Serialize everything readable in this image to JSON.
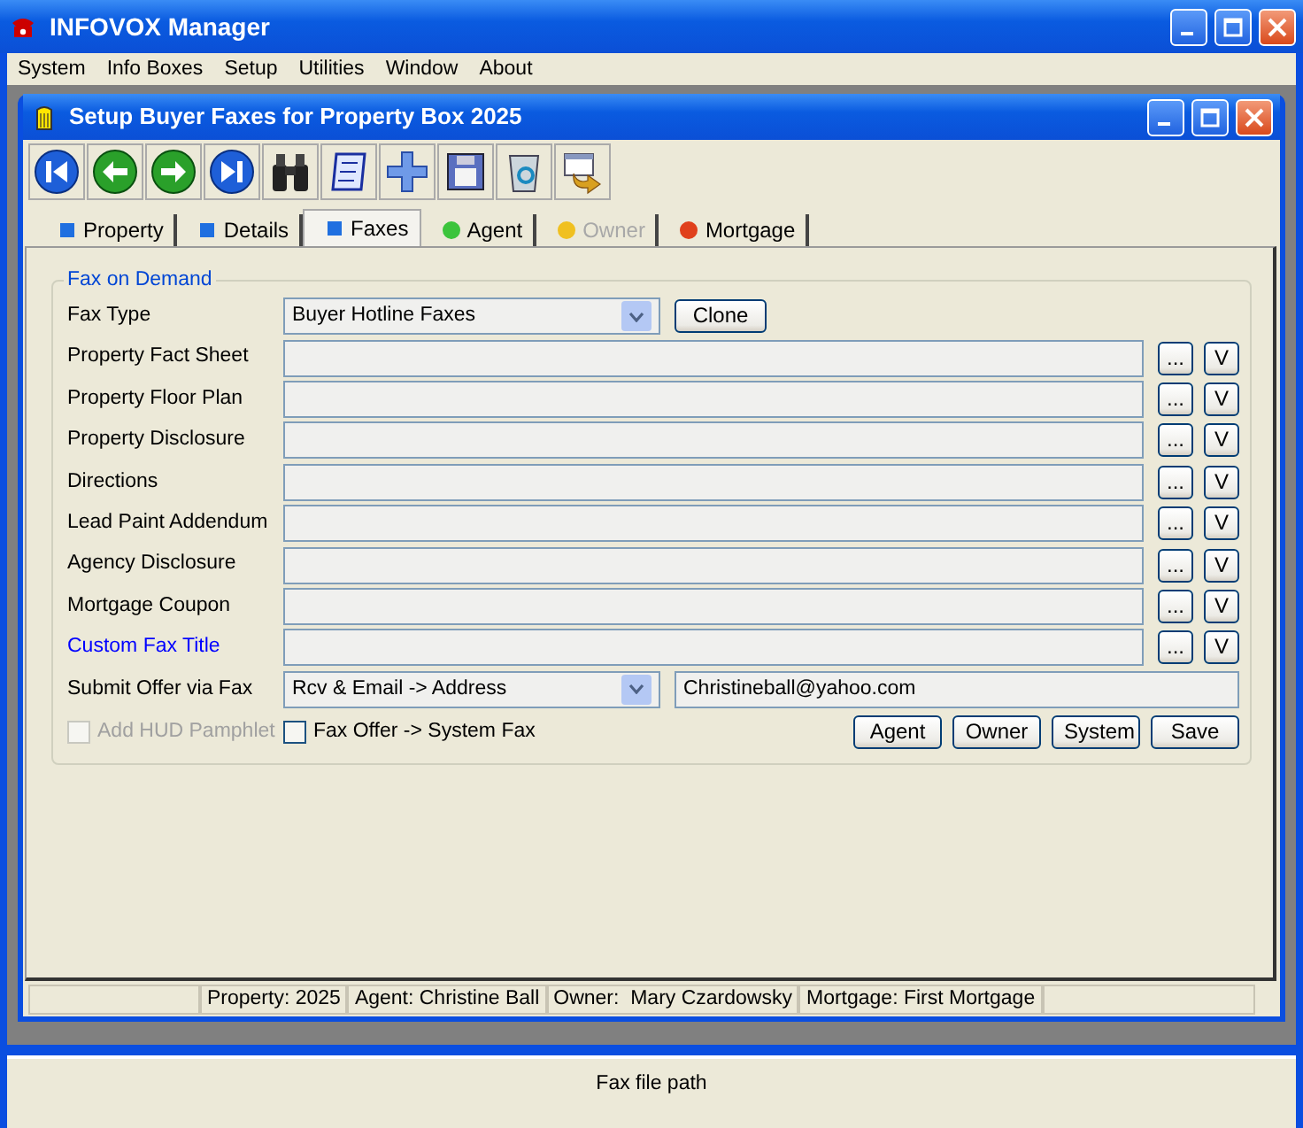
{
  "window": {
    "title": "INFOVOX Manager"
  },
  "menu": [
    "System",
    "Info Boxes",
    "Setup",
    "Utilities",
    "Window",
    "About"
  ],
  "child_window": {
    "title": "Setup Buyer Faxes for Property Box 2025"
  },
  "toolbar": [
    {
      "kind": "first"
    },
    {
      "kind": "prev"
    },
    {
      "kind": "next"
    },
    {
      "kind": "last"
    },
    {
      "kind": "binoculars"
    },
    {
      "kind": "scroll"
    },
    {
      "kind": "add"
    },
    {
      "kind": "save"
    },
    {
      "kind": "recycle"
    },
    {
      "kind": "export"
    }
  ],
  "tabs": [
    {
      "label": "Property",
      "kind": "square",
      "color": "#1f6fe0",
      "selected": false,
      "disabled": false
    },
    {
      "label": "Details",
      "kind": "square",
      "color": "#1f6fe0",
      "selected": false,
      "disabled": false
    },
    {
      "label": "Faxes",
      "kind": "square",
      "color": "#1f6fe0",
      "selected": true,
      "disabled": false
    },
    {
      "label": "Agent",
      "kind": "circle",
      "color": "#3cc43c",
      "selected": false,
      "disabled": false
    },
    {
      "label": "Owner",
      "kind": "circle",
      "color": "#f0c020",
      "selected": false,
      "disabled": true
    },
    {
      "label": "Mortgage",
      "kind": "circle",
      "color": "#e0401c",
      "selected": false,
      "disabled": false
    }
  ],
  "group": {
    "title": "Fax on Demand"
  },
  "fax_type": {
    "label": "Fax Type",
    "value": "Buyer Hotline Faxes",
    "button": "Clone"
  },
  "file_rows": [
    {
      "label": "Property Fact Sheet",
      "highlighted": false,
      "browse": "...",
      "view": "V"
    },
    {
      "label": "Property Floor Plan",
      "highlighted": false,
      "browse": "...",
      "view": "V"
    },
    {
      "label": "Property Disclosure",
      "highlighted": false,
      "browse": "...",
      "view": "V"
    },
    {
      "label": "Directions",
      "highlighted": false,
      "browse": "...",
      "view": "V"
    },
    {
      "label": "Lead Paint Addendum",
      "highlighted": false,
      "browse": "...",
      "view": "V"
    },
    {
      "label": "Agency Disclosure",
      "highlighted": false,
      "browse": "...",
      "view": "V"
    },
    {
      "label": "Mortgage Coupon",
      "highlighted": false,
      "browse": "...",
      "view": "V"
    },
    {
      "label": "Custom Fax Title",
      "highlighted": true,
      "browse": "...",
      "view": "V"
    }
  ],
  "submit": {
    "label": "Submit Offer via Fax",
    "value": "Rcv & Email -> Address",
    "email": "Christineball@yahoo.com"
  },
  "checkboxes": [
    {
      "label": "Add HUD Pamphlet",
      "checked": false,
      "disabled": true
    },
    {
      "label": "Fax Offer -> System Fax",
      "checked": false,
      "disabled": false
    }
  ],
  "buttons": [
    "Agent",
    "Owner",
    "System",
    "Save"
  ],
  "status_panes": [
    "Property: 2025",
    "Agent: Christine Ball",
    "Owner:  Mary Czardowsky",
    "Mortgage: First Mortgage"
  ],
  "status_bar": "Fax file path"
}
